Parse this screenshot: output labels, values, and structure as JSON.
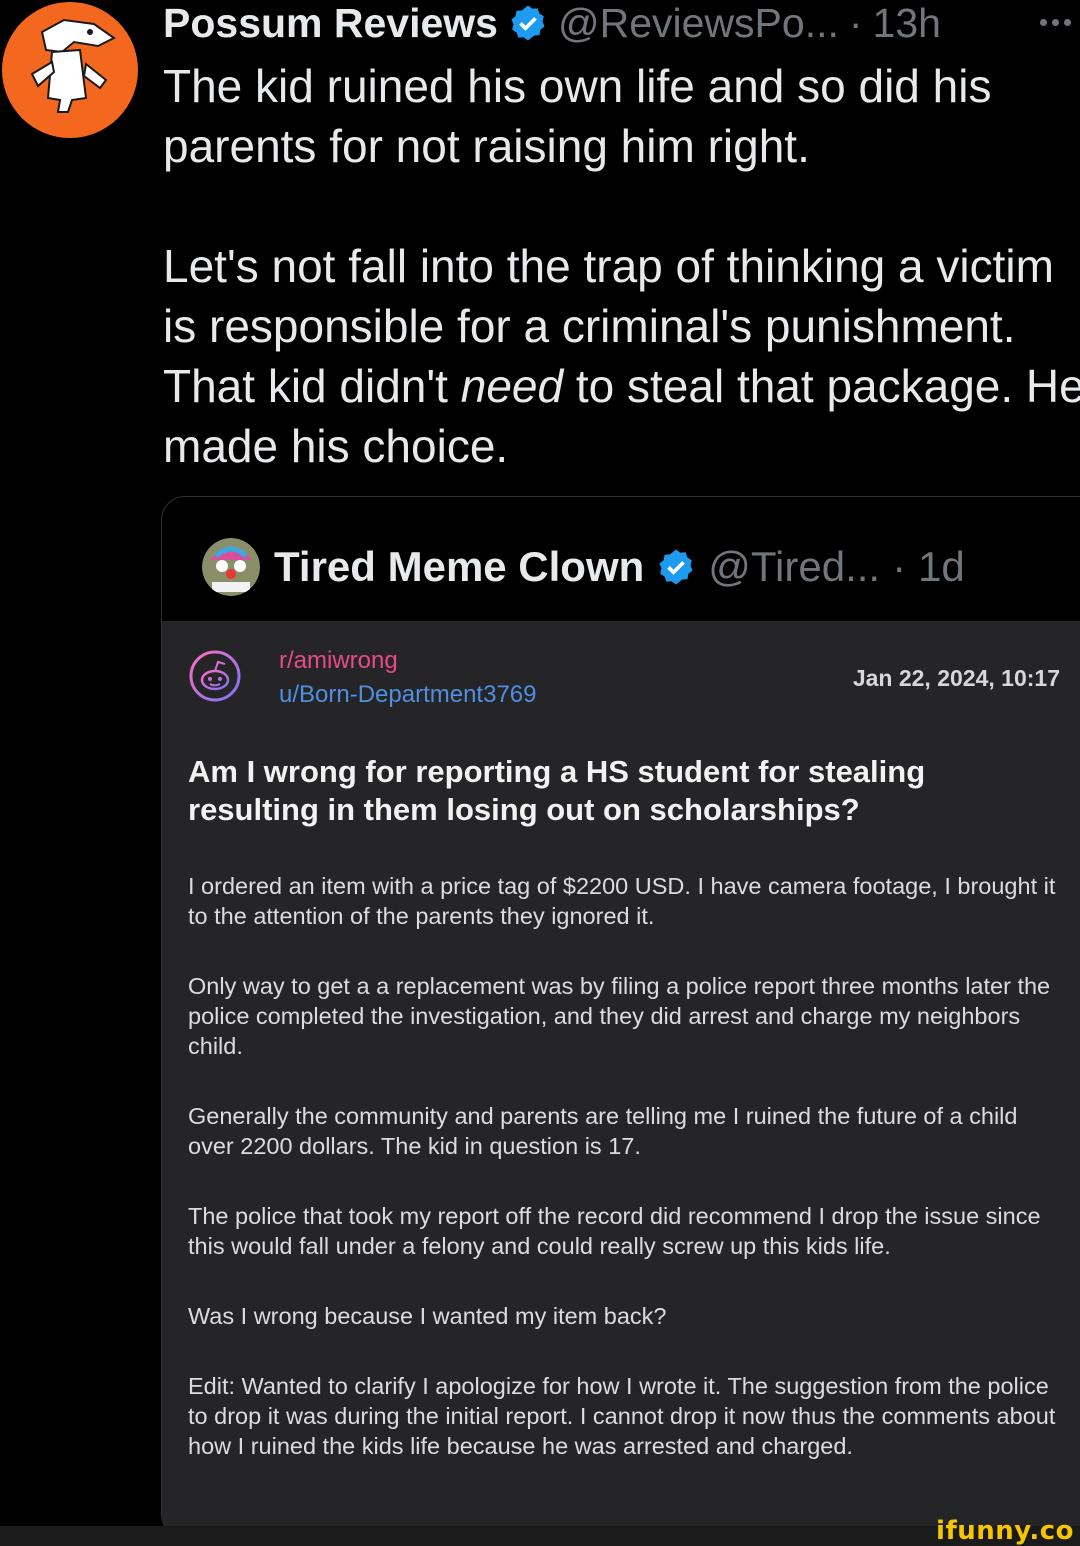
{
  "tweet": {
    "display_name": "Possum Reviews",
    "handle": "@ReviewsPo...",
    "separator": "·",
    "time": "13h",
    "text_p1": "The kid ruined his own life and so did his parents for not raising him right.",
    "text_p2_a": "Let's not fall into the trap of thinking a victim is responsible for a criminal's punishment. That kid didn't ",
    "text_p2_em": "need",
    "text_p2_b": " to steal that package. He made his choice.",
    "colors": {
      "background": "#000000",
      "avatar": "#f4671f",
      "verified": "#1d9bf0"
    }
  },
  "quote": {
    "display_name": "Tired Meme Clown",
    "handle": "@Tired...",
    "separator": "·",
    "time": "1d"
  },
  "reddit_post": {
    "subreddit": "r/amiwrong",
    "username": "u/Born-Department3769",
    "date": "Jan 22, 2024, 10:17",
    "title": "Am I wrong for reporting a HS student for stealing resulting in them losing out on scholarships?",
    "paragraphs": [
      "I ordered an item with a price tag of $2200 USD. I have camera footage, I brought it to the attention of the parents they ignored it.",
      "Only way to get a a replacement was by filing a police report three months later the police completed the investigation, and they did arrest and charge my neighbors child.",
      "Generally the community and parents are telling me I ruined the future of a child over 2200 dollars. The kid in question is 17.",
      "The police that took my report off the record did recommend I drop the issue since this would fall under a felony and  could really screw up this kids life.",
      "Was I wrong because I wanted my item back?",
      "Edit: Wanted to clarify I apologize for how I wrote it. The suggestion from the police to drop it was during the initial report. I cannot drop it now thus the comments about how I ruined the kids life because he was arrested and charged."
    ],
    "colors": {
      "card": "#252527",
      "subreddit": "#e64a8a",
      "username": "#4f8fe0"
    }
  },
  "watermark": {
    "text": "ifunny.co",
    "color": "#f6c600"
  }
}
